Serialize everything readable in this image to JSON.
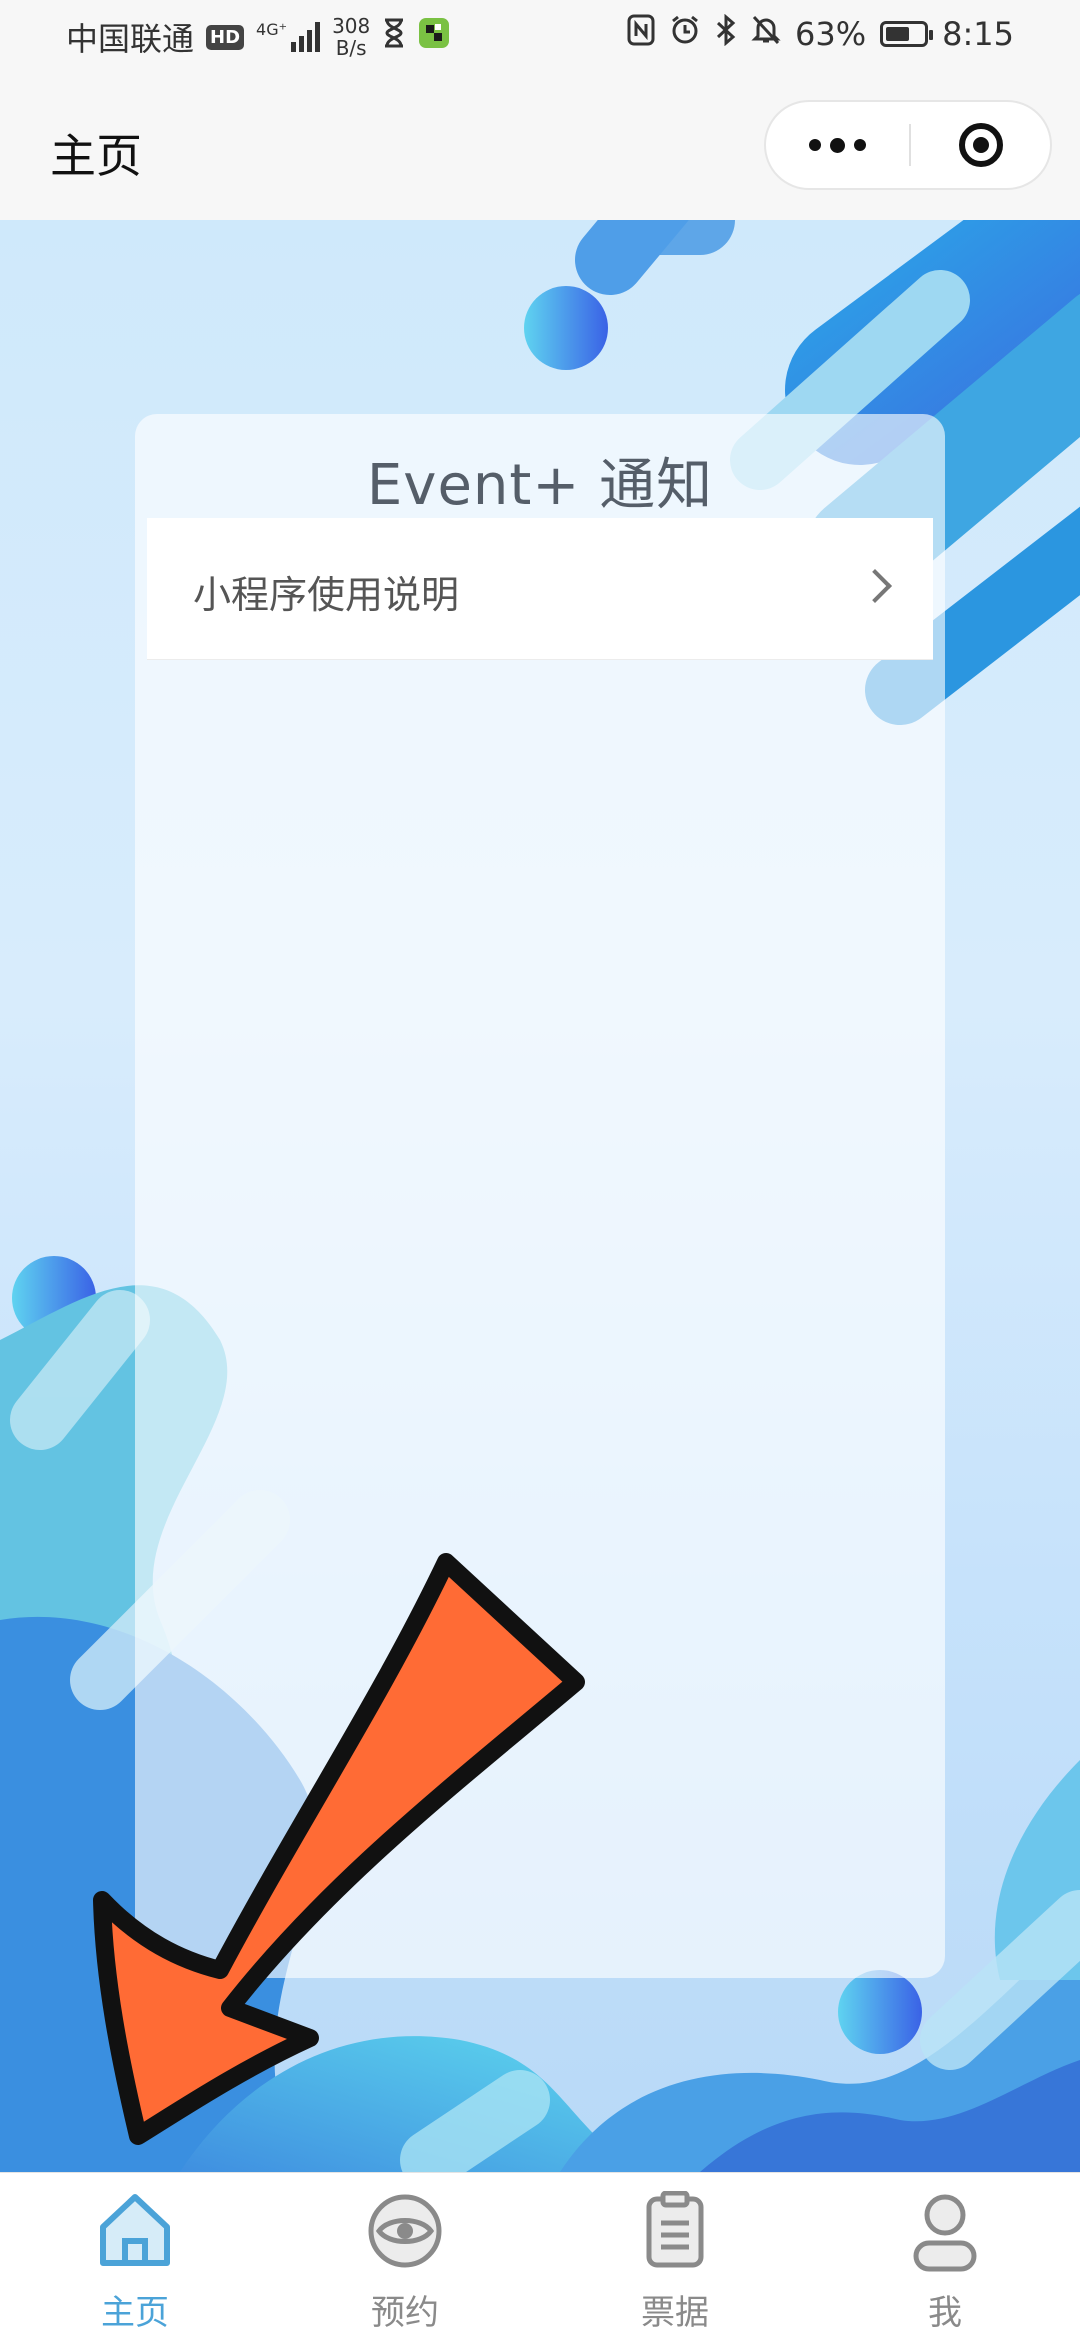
{
  "status_bar": {
    "carrier": "中国联通",
    "hd": "HD",
    "network": "4G⁺",
    "speed_value": "308",
    "speed_unit": "B/s",
    "battery": "63%",
    "battery_level": 0.63,
    "time": "8:15"
  },
  "nav": {
    "title": "主页"
  },
  "card": {
    "title": "Event+ 通知",
    "items": [
      {
        "label": "小程序使用说明"
      }
    ]
  },
  "tabs": [
    {
      "label": "主页",
      "icon": "home-icon",
      "active": true
    },
    {
      "label": "预约",
      "icon": "eye-icon",
      "active": false
    },
    {
      "label": "票据",
      "icon": "receipt-icon",
      "active": false
    },
    {
      "label": "我",
      "icon": "user-icon",
      "active": false
    }
  ],
  "colors": {
    "accent": "#4ba3d8",
    "arrow_fill": "#ff6b35",
    "background_blue": "#3f8fe0"
  }
}
